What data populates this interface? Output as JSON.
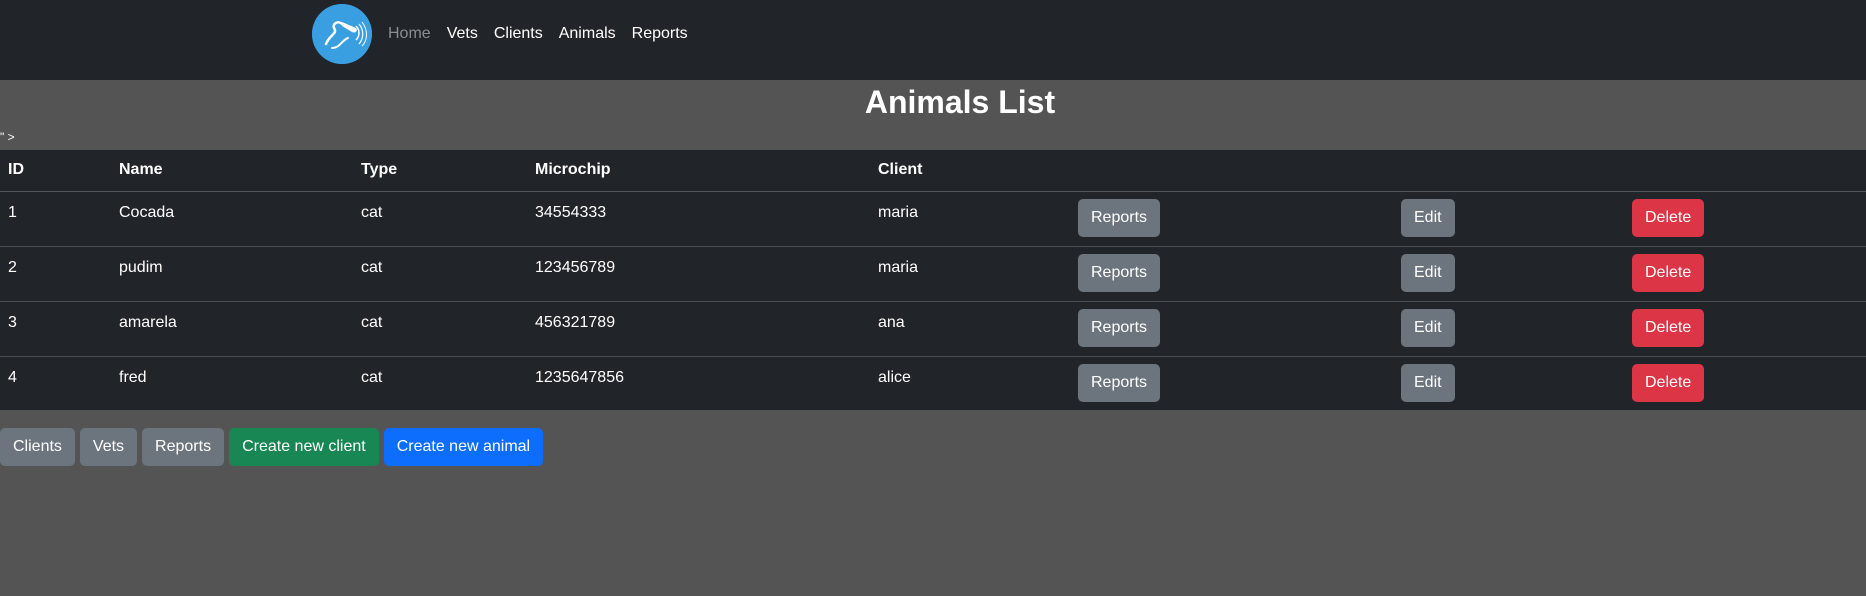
{
  "nav": {
    "logo": "stethoscope-logo",
    "links": [
      "Home",
      "Vets",
      "Clients",
      "Animals",
      "Reports"
    ]
  },
  "page": {
    "title": "Animals List",
    "stray_text": "\" >"
  },
  "table": {
    "headers": [
      "ID",
      "Name",
      "Type",
      "Microchip",
      "Client"
    ],
    "rows": [
      {
        "id": "1",
        "name": "Cocada",
        "type": "cat",
        "microchip": "34554333",
        "client": "maria"
      },
      {
        "id": "2",
        "name": "pudim",
        "type": "cat",
        "microchip": "123456789",
        "client": "maria"
      },
      {
        "id": "3",
        "name": "amarela",
        "type": "cat",
        "microchip": "456321789",
        "client": "ana"
      },
      {
        "id": "4",
        "name": "fred",
        "type": "cat",
        "microchip": "1235647856",
        "client": "alice"
      }
    ],
    "row_actions": {
      "reports": "Reports",
      "edit": "Edit",
      "delete": "Delete"
    }
  },
  "footer": {
    "clients": "Clients",
    "vets": "Vets",
    "reports": "Reports",
    "create_client": "Create new client",
    "create_animal": "Create new animal"
  },
  "colors": {
    "navbar": "#212529",
    "page_bg": "#545454",
    "secondary": "#6c757d",
    "danger": "#dc3545",
    "success": "#198754",
    "primary": "#0d6efd",
    "logo": "#3a9fe0"
  }
}
